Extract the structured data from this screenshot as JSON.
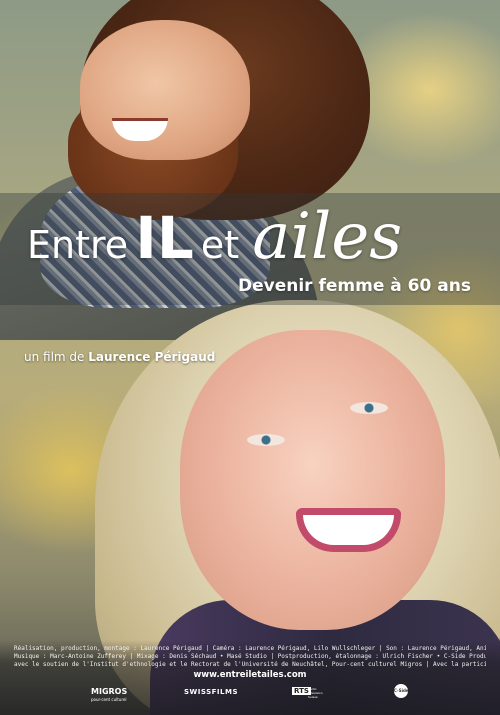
{
  "title": {
    "part1": "Entre",
    "part2": "IL",
    "part3": "et",
    "part4": "ailes"
  },
  "subtitle": "Devenir femme à 60 ans",
  "director": {
    "prefix": "un film de",
    "name": "Laurence Périgaud"
  },
  "credits": {
    "line1": "Réalisation, production, montage : Laurence Périgaud | Caméra : Laurence Périgaud, Lilo Wullschleger | Son : Laurence Périgaud, Anicée Willemin",
    "line2": "Musique : Marc-Antoine Zufferey | Mixage : Denis Séchaud • Masé Studio | Postproduction, étalonnage : Ulrich Fischer • C-Side Productions | Graphisme : Adrienne Barman",
    "line3": "avec le soutien de l'Institut d'ethnologie et le Rectorat de l'Université de Neuchâtel, Pour-cent culturel Migros | Avec la participation de RTS Unité des Films Documentaires, Fonds Regio"
  },
  "website": "www.entreiletailes.com",
  "logos": {
    "migros": "MIGROS",
    "migros_sub": "pour-cent culturel",
    "swissfilms": "SWISSFILMS",
    "rts": "RTS",
    "rts_sub": "Radio Télévision Suisse",
    "cside": "C-Side"
  }
}
